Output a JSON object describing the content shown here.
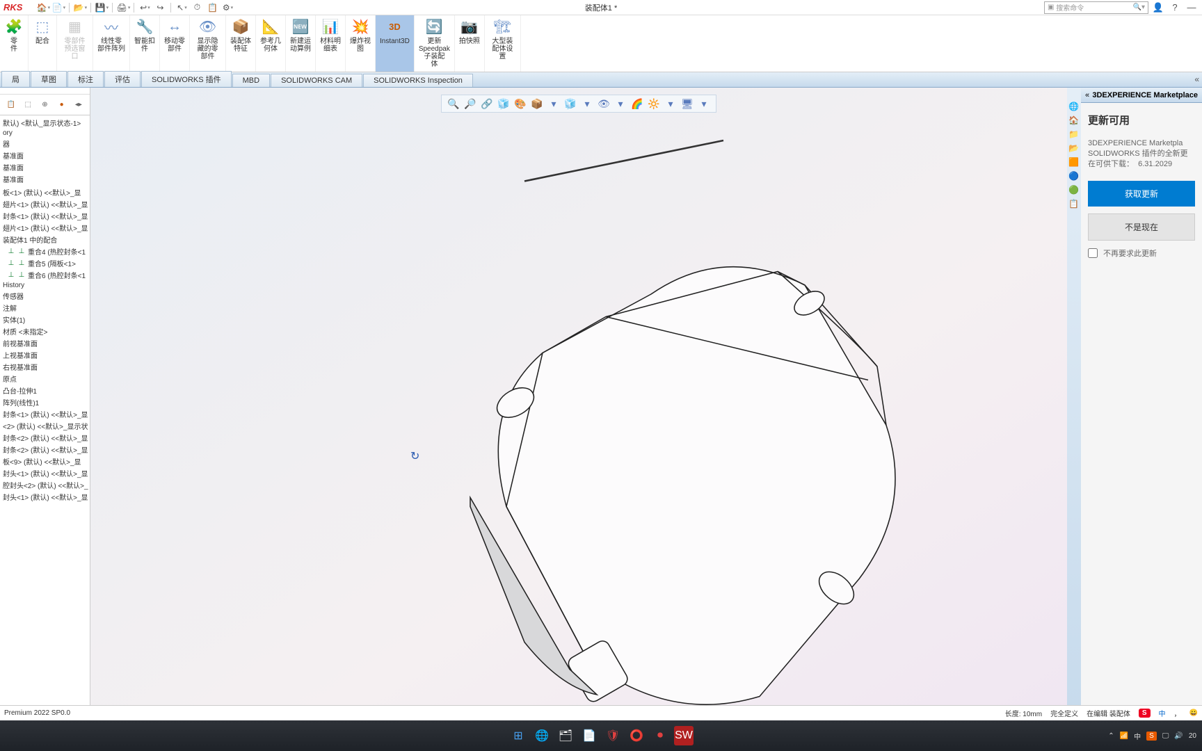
{
  "app": {
    "logo": "RKS",
    "title": "装配体1 *"
  },
  "search": {
    "placeholder": "搜索命令"
  },
  "quick_access": [
    "🏠",
    "📄",
    "📂",
    "💾",
    "🖨",
    "↩",
    "↪",
    "↖",
    "⏱",
    "📋",
    "⚙"
  ],
  "ribbon": [
    {
      "icon": "🧩",
      "label": "零\n件"
    },
    {
      "icon": "⬚",
      "label": "配合"
    },
    {
      "icon": "▦",
      "label": "零部件\n预选窗\n口",
      "dim": true
    },
    {
      "icon": "〰",
      "label": "线性零\n部件阵列"
    },
    {
      "icon": "🔧",
      "label": "智能扣\n件"
    },
    {
      "icon": "↔",
      "label": "移动零\n部件"
    },
    {
      "icon": "👁",
      "label": "显示隐\n藏的零\n部件"
    },
    {
      "icon": "📦",
      "label": "装配体\n特征"
    },
    {
      "icon": "📐",
      "label": "参考几\n何体"
    },
    {
      "icon": "🆕",
      "label": "新建运\n动算例"
    },
    {
      "icon": "📊",
      "label": "材料明\n细表"
    },
    {
      "icon": "💥",
      "label": "爆炸视\n图"
    },
    {
      "icon": "3D",
      "label": "Instant3D",
      "active": true
    },
    {
      "icon": "🔄",
      "label": "更新\nSpeedpak\n子装配\n体"
    },
    {
      "icon": "📷",
      "label": "拍快照"
    },
    {
      "icon": "🏗",
      "label": "大型装\n配体设\n置"
    }
  ],
  "tabs": [
    "局",
    "草图",
    "标注",
    "评估",
    "SOLIDWORKS 插件",
    "MBD",
    "SOLIDWORKS CAM",
    "SOLIDWORKS Inspection"
  ],
  "tree": [
    "默认) <默认_显示状态-1>",
    "ory",
    "器",
    "基准面",
    "基准面",
    "基准面",
    "",
    "板<1> (默认) <<默认>_显",
    "翅片<1> (默认) <<默认>_显",
    "封条<1> (默认) <<默认>_显",
    "翅片<1> (默认) <<默认>_显",
    "装配体1 中的配合",
    "重合4 (热腔封条<1",
    "重合5 (隔板<1>",
    "重合6 (热腔封条<1",
    "History",
    "传感器",
    "注解",
    "实体(1)",
    "材质 <未指定>",
    "前视基准面",
    "上视基准面",
    "右视基准面",
    "原点",
    "凸台-拉伸1",
    "阵列(线性)1",
    "封条<1> (默认) <<默认>_显",
    "<2> (默认) <<默认>_显示状",
    "封条<2> (默认) <<默认>_显",
    "封条<2> (默认) <<默认>_显",
    "板<9> (默认) <<默认>_显",
    "封头<1> (默认) <<默认>_显",
    "腔封头<2> (默认) <<默认>_",
    "封头<1> (默认) <<默认>_显"
  ],
  "mate_indices": [
    12,
    13,
    14
  ],
  "headsup": [
    "🔍",
    "🔎",
    "🔗",
    "🧊",
    "🎨",
    "📦",
    "▾",
    "🧊",
    "▾",
    "👁",
    "▾",
    "🌈",
    "🔆",
    "▾",
    "🖥",
    "▾"
  ],
  "right_icons": [
    "🌐",
    "🏠",
    "📁",
    "📂",
    "🟧",
    "🔵",
    "🟢",
    "📋"
  ],
  "right_panel": {
    "header": "3DEXPERIENCE Marketplace",
    "title": "更新可用",
    "line1": "3DEXPERIENCE Marketpla",
    "line2": "SOLIDWORKS 插件的全新更",
    "line3_pre": "在可供下载：",
    "line3_ver": "6.31.2029",
    "btn_get": "获取更新",
    "btn_later": "不是现在",
    "chk_label": "不再要求此更新"
  },
  "status": {
    "version": "Premium 2022 SP0.0",
    "length": "长度: 10mm",
    "def": "完全定义",
    "edit": "在编辑 装配体"
  },
  "ime": {
    "s": "S",
    "zh": "中"
  },
  "taskbar_time": "20"
}
